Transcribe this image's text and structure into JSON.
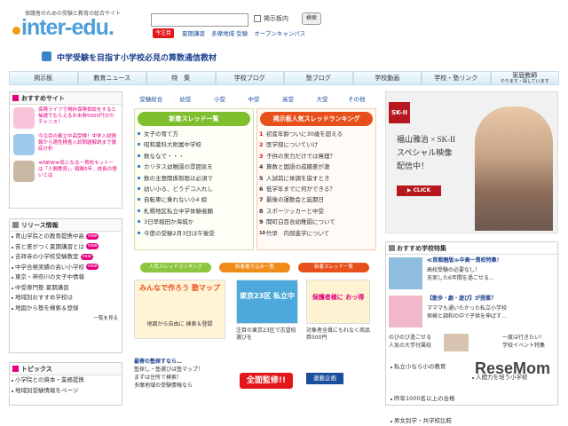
{
  "header": {
    "subtitle": "保護者のための受験と教育の総合サイト",
    "logo": "inter-edu.",
    "board_label": "掲示板内",
    "search_button": "検索",
    "hot_badge": "今注目",
    "links": [
      "夏期講習",
      "多摩地域 受験",
      "オープンキャンパス"
    ],
    "tagline": "中学受験を目指す小学校必見の算数通信教材"
  },
  "nav": [
    {
      "label": "掲示板"
    },
    {
      "label": "教育ニュース"
    },
    {
      "label": "特　集"
    },
    {
      "label": "学校ブログ"
    },
    {
      "label": "塾ブログ"
    },
    {
      "label": "学校動画"
    },
    {
      "label": "学校・塾リンク"
    },
    {
      "label": "家庭教師",
      "sub": "やります・探しています"
    }
  ],
  "left": {
    "recommend_title": "おすすめサイト",
    "promos": [
      "保険ライフで無料保険相談をすると抽選でもらえるお米券5000円分のチャンス！",
      "今注目の都立中高受検！中学入試情報から適性検査入試問題解説まで徹底分析",
      "≪NEW≫気になる一貫校モットーは「人間教育」。戦略5年…校長の想いとは"
    ],
    "release_title": "リリース情報",
    "release_items": [
      {
        "text": "青山学院との教育提携中高",
        "new": "new"
      },
      {
        "text": "苦と差がつく夏期講習とは",
        "new": "new"
      },
      {
        "text": "吉祥寺の小学校受験教室",
        "new": "new"
      },
      {
        "text": "中学合格実績の高い小学校",
        "new": "new"
      },
      {
        "text": "東京・神奈川の女子中情報",
        "new": ""
      },
      {
        "text": "中受専門塾 夏期講習",
        "new": ""
      },
      {
        "text": "地域別おすすめ学校は",
        "new": ""
      },
      {
        "text": "地図から塾を検索＆登録",
        "new": ""
      }
    ],
    "more": "一覧を見る",
    "topics_title": "トピックス",
    "topics": [
      "小学院との資本・業務提携",
      "地域別受験情報をページ"
    ]
  },
  "center": {
    "school_nav": [
      "受験総合",
      "幼受",
      "小受",
      "中受",
      "高受",
      "大受",
      "その他"
    ],
    "new_threads_title": "新着スレッド一覧",
    "new_threads": [
      "女子の育て方",
      "昭和薬科大附属中学校",
      "数ななで・・・",
      "カリタス幼稚園の雰囲気を",
      "数の主張関係制限は必須で",
      "幼い小る、どうデコ入れし",
      "自転車に乗れない小4 娘",
      "札幌地区私立中学体験者願",
      "3日早稲田か海城か",
      "今度の受験2月3日は午後受"
    ],
    "ranking_title": "掲示板人気スレッドランキング",
    "ranking": [
      "初産年齢ついに30歳を超える",
      "医学部についていけ",
      "子供の実力だけでは無理？",
      "算数と国語の成績差が激",
      "入試前に体調を崩すとき",
      "低学年までに何ができる？",
      "最後の運動会と延期日",
      "スポーツッカーと中受",
      "関町白百合幼稚園について",
      "竹早　内部進学について"
    ],
    "tabs": [
      "人気スレッドランキング",
      "新着書き込み一覧",
      "新着スレッド一覧"
    ],
    "ad1_title": "みんなで作ろう 塾マップ",
    "ad1_sub": "地図から自由に 検索＆登録",
    "ad2_title": "東京23区 私立中",
    "ad2_cap": "注目の東京23区で志望校選びを",
    "ad3_title": "保護者様に おっ得",
    "ad3_cap": "対象者全員にもれなく商品券500円",
    "bottom_caps": [
      "最寄の塾探すなら…",
      "塾探し・塾選びは塾マップ！",
      "まずは住所で検索！",
      "多摩地域の受験情報なら"
    ],
    "bottom_badge": "全面監修!!",
    "bottom_badge2": "連載企画"
  },
  "right": {
    "skii_brand": "SK-II",
    "skii_line1": "福山雅治 × SK-II",
    "skii_line2": "スペシャル映像",
    "skii_line3": "配信中！",
    "skii_click": "▶ CLICK",
    "feature_title": "おすすめ学校特集",
    "features": [
      {
        "title": "≪首都圏版≫中高一貫校特集！",
        "lines": [
          "高校受験の必要なし！",
          "充実した6年間を過ごせる…"
        ]
      },
      {
        "title": "【散歩・劇・遊び】が授業？",
        "lines": [
          "マママも通いたかった私立小学校",
          "探検と調和の中で子供を伸ばす…"
        ]
      },
      {
        "title": "",
        "lines": [
          "のびのび過ごせる",
          "人気の大学付属校"
        ]
      },
      {
        "title": "",
        "lines": [
          "一度は行きたい！",
          "学校イベント特集"
        ]
      }
    ],
    "links": [
      "私立小なら小の教育",
      "人間力を培う小学校",
      "昨年1000名以上の合格",
      "男女別学・共学校比較"
    ],
    "watermark": "ReseMom"
  }
}
